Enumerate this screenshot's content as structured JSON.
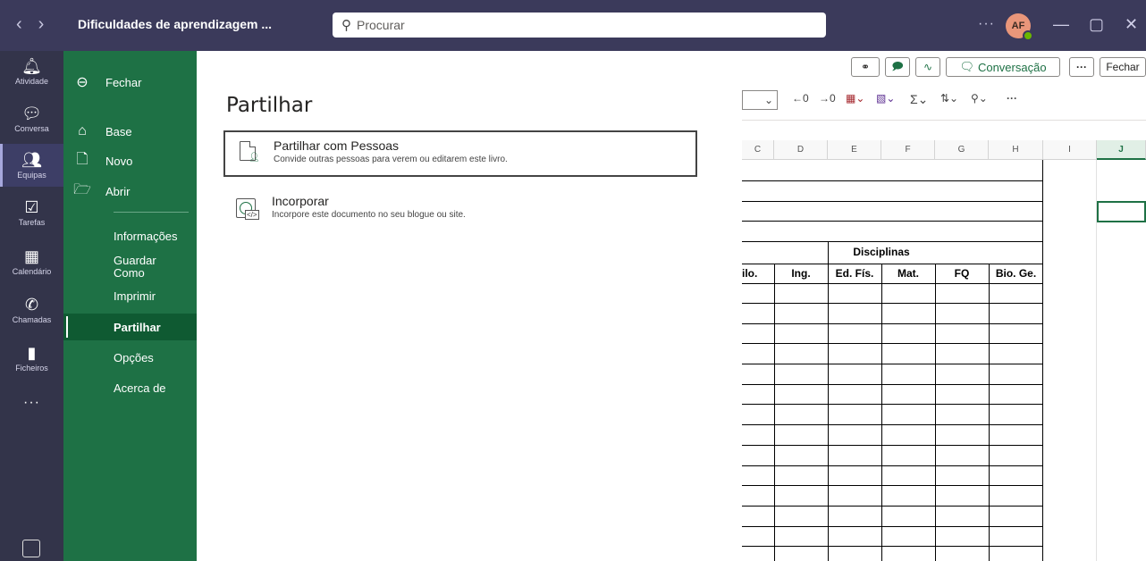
{
  "titlebar": {
    "back_icon": "chevron-left",
    "forward_icon": "chevron-right",
    "doc_title": "Dificuldades de aprendizagem ...",
    "search_placeholder": "Procurar",
    "more": "···",
    "avatar_initials": "AF",
    "minimize": "—",
    "maximize": "▢",
    "close": "✕"
  },
  "rail": {
    "items": [
      {
        "label": "Atividade",
        "icon": "bell-icon"
      },
      {
        "label": "Conversa",
        "icon": "chat-icon"
      },
      {
        "label": "Equipas",
        "icon": "teams-icon"
      },
      {
        "label": "Tarefas",
        "icon": "tasks-icon"
      },
      {
        "label": "Calendário",
        "icon": "calendar-icon"
      },
      {
        "label": "Chamadas",
        "icon": "phone-icon"
      },
      {
        "label": "Ficheiros",
        "icon": "file-icon"
      }
    ],
    "more": "···",
    "active": "Equipas"
  },
  "backstage": {
    "close": "Fechar",
    "home": "Base",
    "new": "Novo",
    "open": "Abrir",
    "info": "Informações",
    "save_as_1": "Guardar",
    "save_as_2": "Como",
    "print": "Imprimir",
    "share": "Partilhar",
    "options": "Opções",
    "about": "Acerca de"
  },
  "share_panel": {
    "title": "Partilhar",
    "options": [
      {
        "title": "Partilhar com Pessoas",
        "desc": "Convide outras pessoas para verem ou editarem este livro."
      },
      {
        "title": "Incorporar",
        "desc": "Incorpore este documento no seu blogue ou site."
      }
    ]
  },
  "excel": {
    "conversation": "Conversação",
    "close": "Fechar",
    "more": "···",
    "columns": [
      "C",
      "D",
      "E",
      "F",
      "G",
      "H",
      "I",
      "J"
    ],
    "table_group_header": "Disciplinas",
    "table_headers": [
      "ilo.",
      "Ing.",
      "Ed. Fís.",
      "Mat.",
      "FQ",
      "Bio. Ge."
    ],
    "ribbon_icons": [
      "increase-decimal",
      "decrease-decimal",
      "table-icon",
      "format-icon",
      "sum-icon",
      "sort-filter-icon",
      "find-icon",
      "more-icon"
    ],
    "selected_column": "J"
  }
}
